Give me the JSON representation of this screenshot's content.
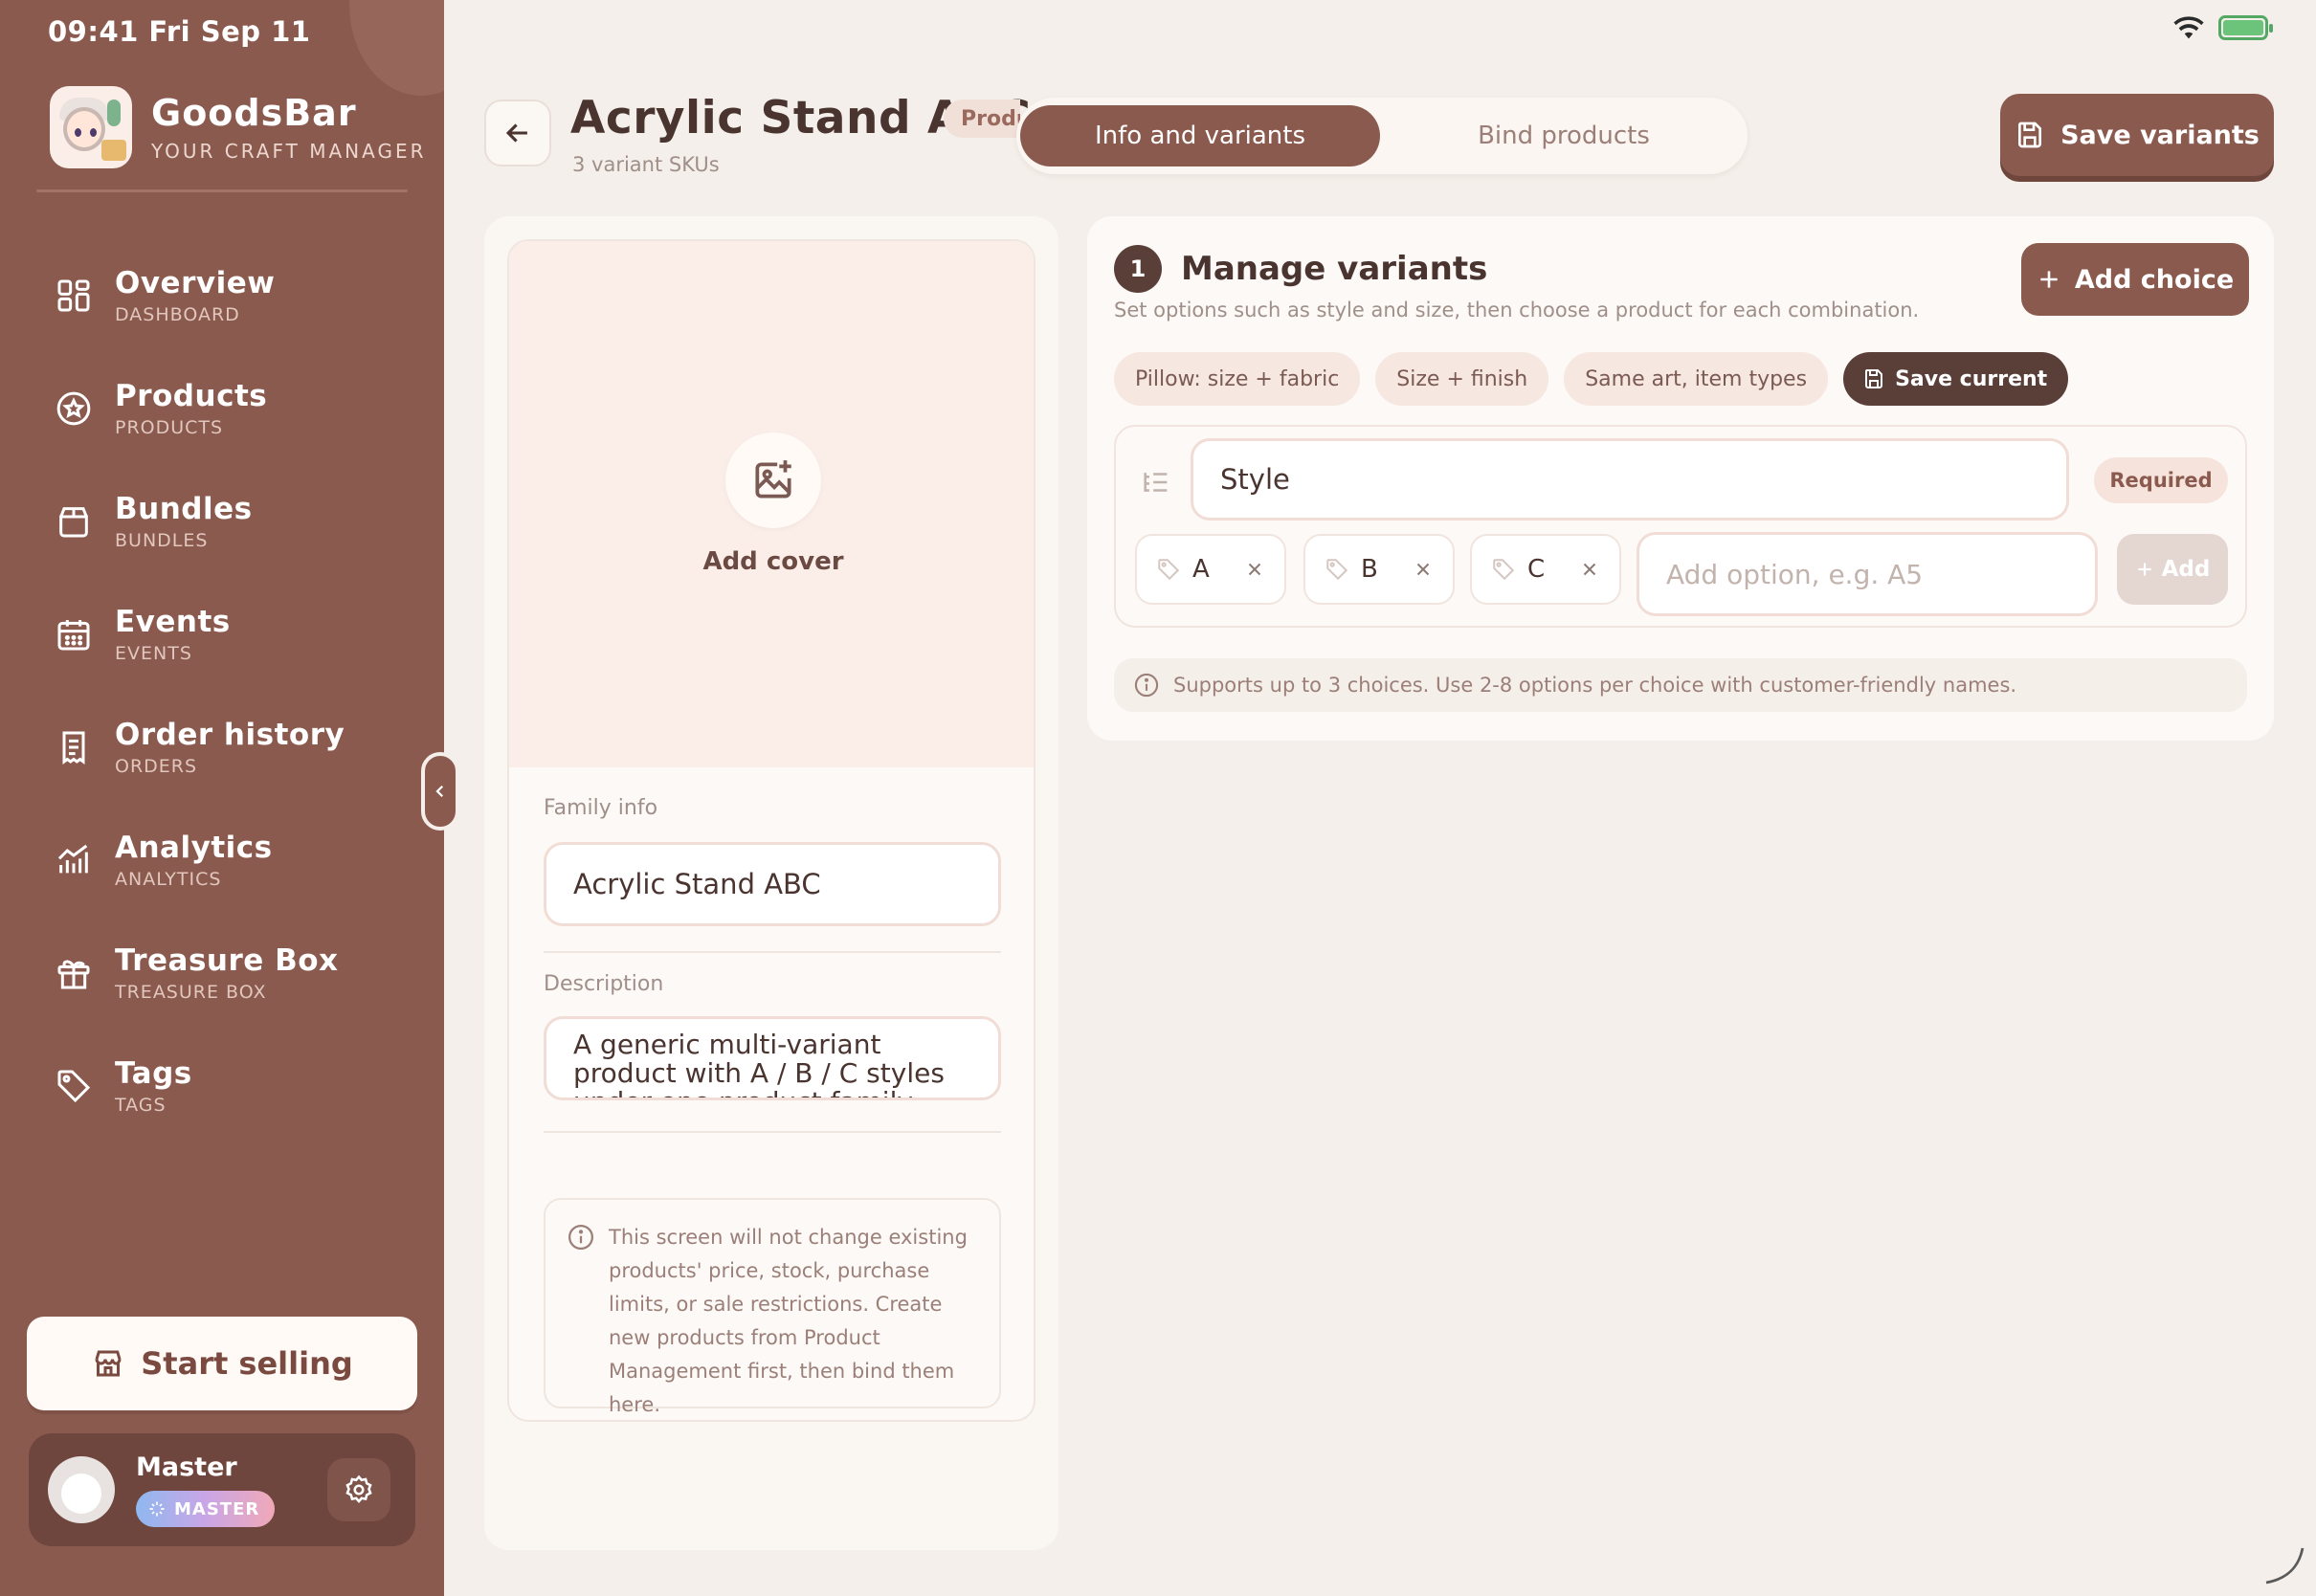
{
  "status": {
    "time": "09:41  Fri Sep 11"
  },
  "brand": {
    "name": "GoodsBar",
    "tagline": "YOUR CRAFT MANAGER"
  },
  "nav": {
    "items": [
      {
        "title": "Overview",
        "sub": "DASHBOARD",
        "icon": "grid-icon"
      },
      {
        "title": "Products",
        "sub": "PRODUCTS",
        "icon": "star-circle-icon"
      },
      {
        "title": "Bundles",
        "sub": "BUNDLES",
        "icon": "box-icon"
      },
      {
        "title": "Events",
        "sub": "EVENTS",
        "icon": "calendar-icon"
      },
      {
        "title": "Order history",
        "sub": "ORDERS",
        "icon": "receipt-icon"
      },
      {
        "title": "Analytics",
        "sub": "ANALYTICS",
        "icon": "chart-icon"
      },
      {
        "title": "Treasure Box",
        "sub": "TREASURE BOX",
        "icon": "gift-icon"
      },
      {
        "title": "Tags",
        "sub": "TAGS",
        "icon": "tag-icon"
      }
    ]
  },
  "start_selling": {
    "label": "Start selling"
  },
  "profile": {
    "name": "Master",
    "badge": "MASTER"
  },
  "header": {
    "title": "Acrylic Stand ABC",
    "badge": "Product",
    "subtitle": "3 variant SKUs",
    "save_label": "Save variants"
  },
  "tabs": [
    {
      "label": "Info and variants",
      "active": true
    },
    {
      "label": "Bind products",
      "active": false
    }
  ],
  "left_panel": {
    "cover_label": "Add cover",
    "family_label": "Family info",
    "family_value": "Acrylic Stand ABC",
    "description_label": "Description",
    "description_value": "A generic multi-variant product with A / B / C styles under one product family.",
    "note": "This screen will not change existing products' price, stock, purchase limits, or sale restrictions. Create new products from Product Management first, then bind them here."
  },
  "variants": {
    "step": "1",
    "title": "Manage variants",
    "subtitle": "Set options such as style and size, then choose a product for each combination.",
    "add_choice_label": "Add choice",
    "presets": [
      "Pillow: size + fabric",
      "Size + finish",
      "Same art, item types"
    ],
    "save_current_label": "Save current",
    "choice": {
      "name": "Style",
      "required_label": "Required",
      "options": [
        "A",
        "B",
        "C"
      ],
      "add_option_placeholder": "Add option, e.g. A5",
      "add_option_label": "Add"
    },
    "info": "Supports up to 3 choices. Use 2-8 options per choice with customer-friendly names."
  },
  "colors": {
    "sidebar": "#8b5a4e",
    "accent": "#8b5a4e",
    "background": "#f4efea",
    "dark_chip": "#5a3f39"
  }
}
